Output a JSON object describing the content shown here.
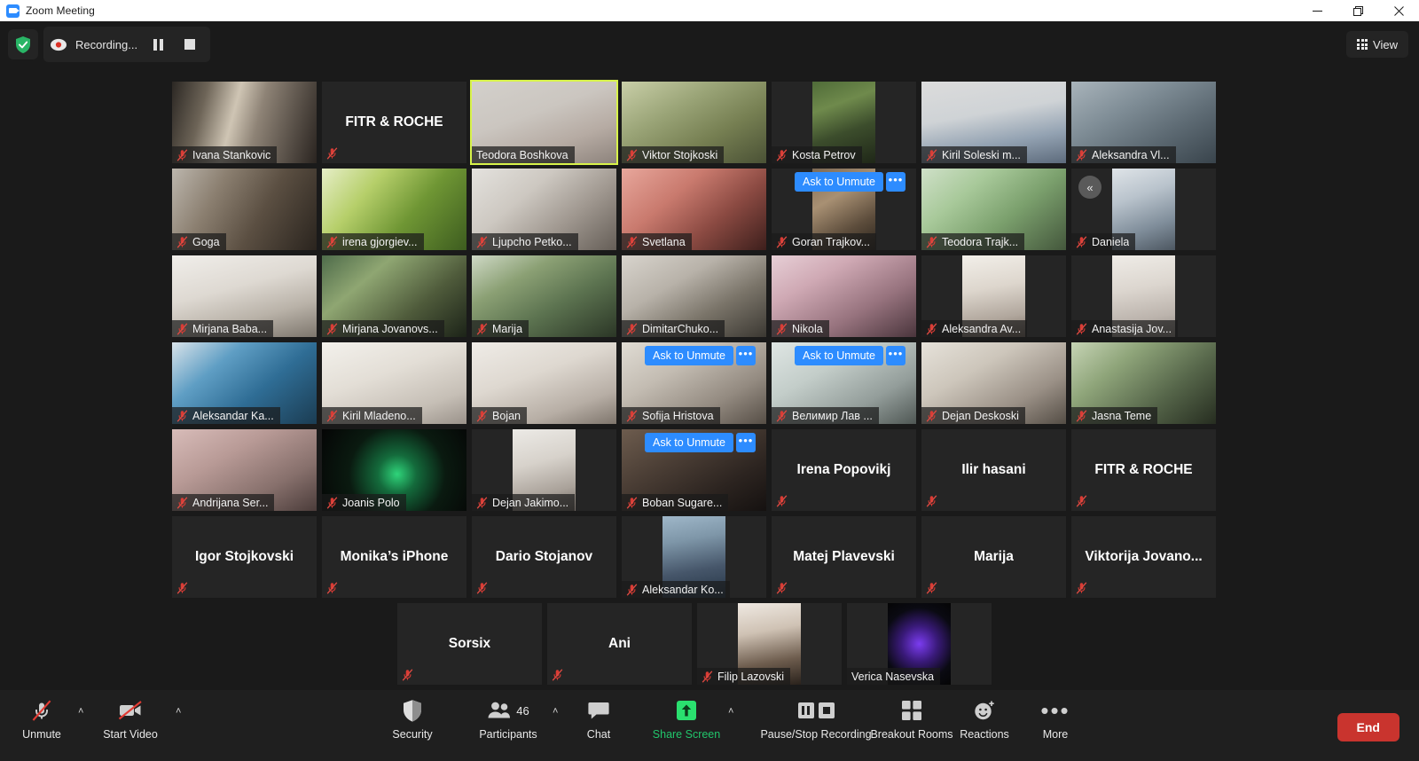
{
  "window": {
    "title": "Zoom Meeting",
    "app_icon": "zoom-icon",
    "controls": {
      "minimize": "minimize-icon",
      "maximize": "maximize-icon",
      "close": "close-icon"
    }
  },
  "topbar": {
    "shield_icon": "encryption-shield-icon",
    "recording_label": "Recording...",
    "recording_dot_icon": "record-dot-icon",
    "pause_recording_icon": "pause-icon",
    "stop_recording_icon": "stop-icon",
    "view_label": "View",
    "view_icon": "grid-icon"
  },
  "gallery": {
    "collapse_label": "«",
    "ask_to_unmute_label": "Ask to Unmute",
    "more_label": "•••",
    "active_speaker": "Teodora Boshkova",
    "active_border_color": "#d8f34a",
    "ask_button_color": "#2d8cff",
    "rows": [
      [
        {
          "name": "Ivana Stankovic",
          "video": true,
          "muted": true,
          "bg": "linear-gradient(105deg,#2b2723 0%,#6d6457 22%,#cfc5b4 42%,#8e8376 58%,#2a2420 100%)"
        },
        {
          "name": "",
          "video": false,
          "muted": true,
          "center_text": "FITR & ROCHE"
        },
        {
          "name": "Teodora Boshkova",
          "video": true,
          "muted": false,
          "active": true,
          "bg": "linear-gradient(160deg,#d3d0cb 0%,#cbc6c0 40%,#b6aba3 70%,#8d837c 100%)"
        },
        {
          "name": "Viktor Stojkoski",
          "video": true,
          "muted": true,
          "bg": "linear-gradient(150deg,#c9cfa8 0%,#9aa477 35%,#767f52 65%,#4a5135 100%)"
        },
        {
          "name": "Kosta Petrov",
          "video": true,
          "muted": true,
          "contain": true,
          "bg": "linear-gradient(160deg,#4f6b38 0%,#6f8a4c 30%,#3c4d2c 60%,#1f2718 100%)"
        },
        {
          "name": "Kiril Soleski m...",
          "video": true,
          "muted": true,
          "bg": "linear-gradient(170deg,#dcdcdc 0%,#cfd3d6 40%,#93a2b2 70%,#5d6b7c 100%)"
        },
        {
          "name": "Aleksandra Vl...",
          "video": true,
          "muted": true,
          "bg": "linear-gradient(150deg,#a9b4bb 0%,#7f8d96 35%,#5d6a73 65%,#39444c 100%)"
        }
      ],
      [
        {
          "name": "Goga",
          "video": true,
          "muted": true,
          "bg": "linear-gradient(120deg,#bcb6ad 0%,#8b7f70 30%,#5b4f42 60%,#2a241e 100%)"
        },
        {
          "name": "irena gjorgiev...",
          "video": true,
          "muted": true,
          "bg": "linear-gradient(130deg,#e6eec7 0%,#b6cf6a 30%,#6f9634 60%,#3d5c1f 100%)"
        },
        {
          "name": "Ljupcho Petko...",
          "video": true,
          "muted": true,
          "bg": "linear-gradient(140deg,#e4e2de 0%,#cdc8c1 35%,#a09890 65%,#655e57 100%)"
        },
        {
          "name": "Svetlana",
          "video": true,
          "muted": true,
          "bg": "linear-gradient(140deg,#e8a79c 0%,#c97a6e 35%,#8b4a42 65%,#3d1f1c 100%)"
        },
        {
          "name": "Goran Trajkov...",
          "video": true,
          "muted": true,
          "contain": true,
          "ask_to_unmute": true,
          "bg": "linear-gradient(150deg,#7d6a55 0%,#a89073 35%,#5d4d3c 70%,#2b241c 100%)"
        },
        {
          "name": "Teodora Trajk...",
          "video": true,
          "muted": true,
          "bg": "linear-gradient(140deg,#cfe0c8 0%,#a8c99a 30%,#7ba06d 60%,#44573c 100%)"
        },
        {
          "name": "Daniela",
          "video": true,
          "muted": true,
          "contain": true,
          "collapse": true,
          "bg": "linear-gradient(160deg,#dfe4e8 0%,#b9c3cc 35%,#7f8d9a 70%,#4d5761 100%)"
        }
      ],
      [
        {
          "name": "Mirjana Baba...",
          "video": true,
          "muted": true,
          "bg": "linear-gradient(165deg,#f0eeea 0%,#ded9d2 40%,#b9b2a8 70%,#7d766d 100%)"
        },
        {
          "name": "Mirjana Jovanovs...",
          "video": true,
          "muted": true,
          "bg": "linear-gradient(140deg,#4e6b4a 0%,#8fa672 30%,#4f5b3b 65%,#1c2318 100%)"
        },
        {
          "name": "Marija",
          "video": true,
          "muted": true,
          "bg": "linear-gradient(150deg,#cfd9c6 0%,#8ba074 30%,#5c7350 60%,#2b3626 100%)"
        },
        {
          "name": "DimitarChuko...",
          "video": true,
          "muted": true,
          "bg": "linear-gradient(150deg,#d8d4cd 0%,#b8b2a9 35%,#7a7469 65%,#3b3832 100%)"
        },
        {
          "name": "Nikola",
          "video": true,
          "muted": true,
          "bg": "linear-gradient(150deg,#e7cfd6 0%,#cfa9b4 30%,#97737e 65%,#4a353c 100%)"
        },
        {
          "name": "Aleksandra Av...",
          "video": true,
          "muted": true,
          "contain": true,
          "bg": "linear-gradient(170deg,#f2efe9 0%,#ddd6cd 40%,#b0a69c 75%,#76695f 100%)"
        },
        {
          "name": "Anastasija Jov...",
          "video": true,
          "muted": true,
          "contain": true,
          "bg": "linear-gradient(170deg,#efece7 0%,#dcd6cf 40%,#bbb3ac 75%,#8c857e 100%)"
        }
      ],
      [
        {
          "name": "Aleksandar Ka...",
          "video": true,
          "muted": true,
          "bg": "linear-gradient(140deg,#d9e3ea 0%,#5f9ec4 30%,#2f6d95 60%,#1b3c52 100%)"
        },
        {
          "name": "Kiril Mladeno...",
          "video": true,
          "muted": true,
          "bg": "linear-gradient(160deg,#f3f1ec 0%,#e3ded6 40%,#c6bfb6 75%,#9a928a 100%)"
        },
        {
          "name": "Bojan",
          "video": true,
          "muted": true,
          "bg": "linear-gradient(160deg,#efece7 0%,#ded8d0 40%,#b7aea5 75%,#7e756c 100%)"
        },
        {
          "name": "Sofija Hristova",
          "video": true,
          "muted": true,
          "ask_to_unmute": true,
          "bg": "linear-gradient(150deg,#e0dcd4 0%,#c3bcb2 35%,#938a80 70%,#564e46 100%)"
        },
        {
          "name": "Велимир Лав ...",
          "video": true,
          "muted": true,
          "ask_to_unmute": true,
          "bg": "linear-gradient(150deg,#dfe6e4 0%,#c3cdc9 35%,#939d9a 70%,#4f5754 100%)"
        },
        {
          "name": "Dejan Deskoski",
          "video": true,
          "muted": true,
          "bg": "linear-gradient(150deg,#e6e2da 0%,#cdc6bb 35%,#9a9086 70%,#544d45 100%)"
        },
        {
          "name": "Jasna Teme",
          "video": true,
          "muted": true,
          "bg": "linear-gradient(140deg,#c6d4b5 0%,#8fa57a 30%,#56664a 65%,#262d20 100%)"
        }
      ],
      [
        {
          "name": "Andrijana Ser...",
          "video": true,
          "muted": true,
          "bg": "linear-gradient(150deg,#d8bcb9 0%,#b89a96 35%,#87706c 70%,#4b3c3a 100%)"
        },
        {
          "name": "Joanis Polo",
          "video": true,
          "muted": true,
          "bg": "radial-gradient(circle at 52% 55%, #2fd47a 0%, #146b3c 22%, #0a1a10 55%, #050505 100%)"
        },
        {
          "name": "Dejan Jakimo...",
          "video": true,
          "muted": true,
          "contain": true,
          "bg": "linear-gradient(165deg,#eceae6 0%,#d7d2cb 40%,#a9a199 75%,#6e6760 100%)"
        },
        {
          "name": "Boban Sugare...",
          "video": true,
          "muted": true,
          "ask_to_unmute": true,
          "bg": "linear-gradient(150deg,#6d5c4e 0%,#4c3f36 35%,#2c2420 70%,#151110 100%)"
        },
        {
          "name": "",
          "video": false,
          "muted": true,
          "center_text": "Irena Popovikj"
        },
        {
          "name": "",
          "video": false,
          "muted": true,
          "center_text": "Ilir hasani"
        },
        {
          "name": "",
          "video": false,
          "muted": true,
          "center_text": "FITR & ROCHE"
        }
      ],
      [
        {
          "name": "",
          "video": false,
          "muted": true,
          "center_text": "Igor Stojkovski"
        },
        {
          "name": "",
          "video": false,
          "muted": true,
          "center_text": "Monika’s iPhone"
        },
        {
          "name": "",
          "video": false,
          "muted": true,
          "center_text": "Dario Stojanov"
        },
        {
          "name": "Aleksandar Ko...",
          "video": true,
          "muted": true,
          "contain": true,
          "bg": "linear-gradient(170deg,#9fb7c9 0%,#7e96a8 30%,#46566a 65%,#243444 100%)"
        },
        {
          "name": "",
          "video": false,
          "muted": true,
          "center_text": "Matej Plavevski"
        },
        {
          "name": "",
          "video": false,
          "muted": true,
          "center_text": "Marija"
        },
        {
          "name": "",
          "video": false,
          "muted": true,
          "center_text": "Viktorija  Jovano..."
        }
      ],
      [
        {
          "name": "",
          "video": false,
          "muted": true,
          "center_text": "Sorsix"
        },
        {
          "name": "",
          "video": false,
          "muted": true,
          "center_text": "Ani"
        },
        {
          "name": "Filip Lazovski",
          "video": true,
          "muted": true,
          "contain": true,
          "bg": "linear-gradient(170deg,#efe9e2 0%,#cfc2b4 35%,#6e5d4e 70%,#2a221c 100%)"
        },
        {
          "name": "Verica Nasevska",
          "video": true,
          "muted": false,
          "contain": true,
          "bg": "radial-gradient(circle at 50% 50%, #7b3cf0 0%, #3a1a7a 35%, #0a0a12 70%, #050505 100%)"
        }
      ]
    ]
  },
  "toolbar": {
    "items": [
      {
        "id": "unmute",
        "label": "Unmute",
        "icon": "mic-muted-icon",
        "caret": true
      },
      {
        "id": "video",
        "label": "Start Video",
        "icon": "camera-muted-icon",
        "caret": true
      },
      {
        "id": "security",
        "label": "Security",
        "icon": "shield-icon",
        "caret": false
      },
      {
        "id": "participants",
        "label": "Participants",
        "icon": "people-icon",
        "caret": true,
        "badge": "46"
      },
      {
        "id": "chat",
        "label": "Chat",
        "icon": "chat-bubble-icon",
        "caret": false
      },
      {
        "id": "share",
        "label": "Share Screen",
        "icon": "share-arrow-up-icon",
        "caret": true,
        "accent": "#21c56b"
      },
      {
        "id": "recording",
        "label": "Pause/Stop Recording",
        "icon": "pause-stop-icon",
        "caret": false
      },
      {
        "id": "breakout",
        "label": "Breakout Rooms",
        "icon": "breakout-grid-icon",
        "caret": false
      },
      {
        "id": "reactions",
        "label": "Reactions",
        "icon": "smiley-plus-icon",
        "caret": false
      },
      {
        "id": "more",
        "label": "More",
        "icon": "ellipsis-icon",
        "caret": false
      }
    ],
    "end_label": "End",
    "end_color": "#c9342e"
  }
}
